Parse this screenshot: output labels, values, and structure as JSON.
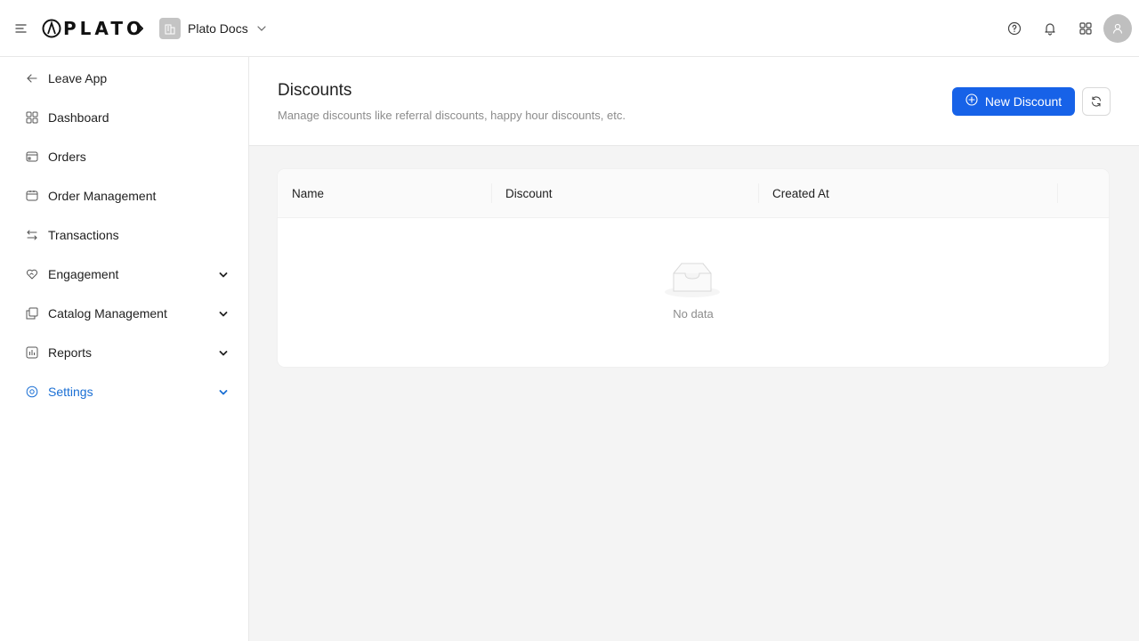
{
  "header": {
    "logo_text": "PLATO",
    "workspace_name": "Plato Docs",
    "icons": [
      "menu-icon",
      "chevron-right-icon",
      "building-icon",
      "chevron-down-icon",
      "help-icon",
      "bell-icon",
      "apps-grid-icon",
      "user-icon"
    ]
  },
  "sidebar": {
    "items": [
      {
        "label": "Leave App",
        "icon": "arrow-left-icon"
      },
      {
        "label": "Dashboard",
        "icon": "dashboard-icon"
      },
      {
        "label": "Orders",
        "icon": "orders-icon"
      },
      {
        "label": "Order Management",
        "icon": "order-management-icon"
      },
      {
        "label": "Transactions",
        "icon": "swap-icon"
      },
      {
        "label": "Engagement",
        "icon": "heart-handshake-icon",
        "expandable": true
      },
      {
        "label": "Catalog Management",
        "icon": "catalog-icon",
        "expandable": true
      },
      {
        "label": "Reports",
        "icon": "bar-chart-icon",
        "expandable": true
      },
      {
        "label": "Settings",
        "icon": "settings-icon",
        "expandable": true,
        "active": true
      }
    ]
  },
  "page": {
    "title": "Discounts",
    "description": "Manage discounts like referral discounts, happy hour discounts, etc.",
    "new_button_label": "New Discount"
  },
  "table": {
    "columns": [
      "Name",
      "Discount",
      "Created At"
    ],
    "empty_text": "No data"
  },
  "colors": {
    "primary": "#1762e8",
    "active_nav": "#1a6fd4",
    "background": "#f4f4f4"
  }
}
